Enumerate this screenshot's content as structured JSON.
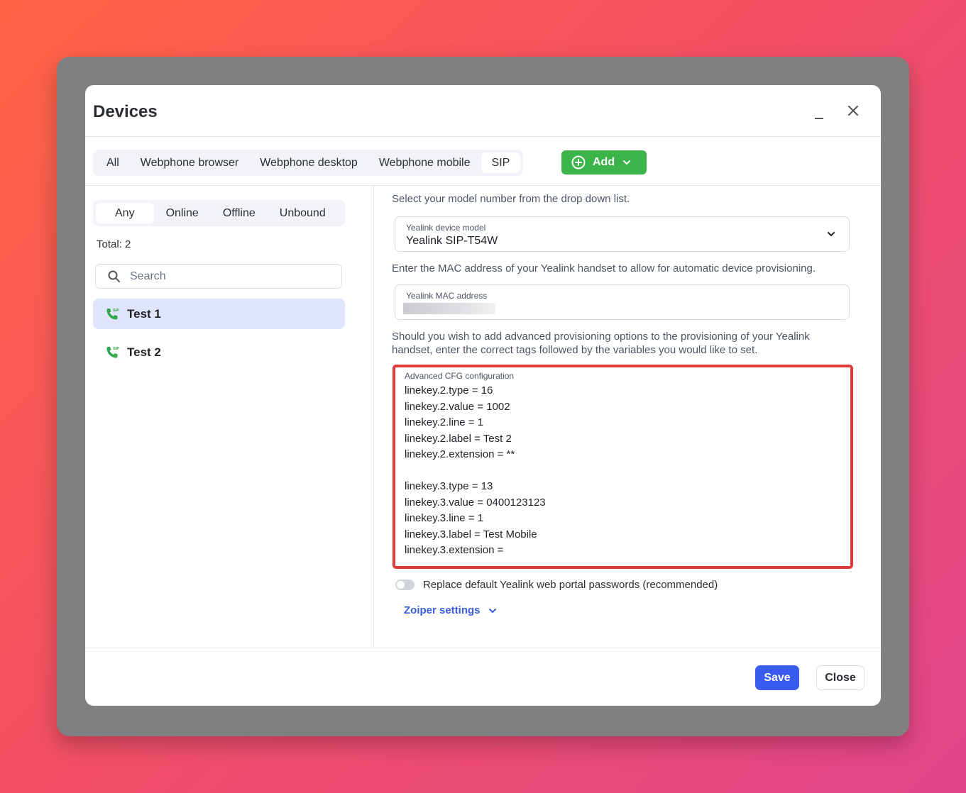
{
  "dialog": {
    "title": "Devices"
  },
  "tabs": [
    {
      "label": "All"
    },
    {
      "label": "Webphone browser"
    },
    {
      "label": "Webphone desktop"
    },
    {
      "label": "Webphone mobile"
    },
    {
      "label": "SIP",
      "active": true
    }
  ],
  "add_button": {
    "label": "Add"
  },
  "status_filter": [
    {
      "label": "Any",
      "active": true
    },
    {
      "label": "Online"
    },
    {
      "label": "Offline"
    },
    {
      "label": "Unbound"
    }
  ],
  "total": "Total: 2",
  "search": {
    "placeholder": "Search",
    "value": ""
  },
  "devices": [
    {
      "label": "Test 1",
      "selected": true,
      "icon": "sip-phone-icon"
    },
    {
      "label": "Test 2",
      "selected": false,
      "icon": "sip-phone-icon"
    }
  ],
  "config": {
    "model_hint": "Select your model number from the drop down list.",
    "model_field": {
      "label": "Yealink device model",
      "value": "Yealink SIP-T54W"
    },
    "mac_hint": "Enter the MAC address of your Yealink handset to allow for automatic device provisioning.",
    "mac_field": {
      "label": "Yealink MAC address",
      "value": ""
    },
    "advanced_hint_line1": "Should you wish to add advanced provisioning options to the provisioning of your Yealink",
    "advanced_hint_line2": "handset, enter the correct tags followed by the variables you would like to set.",
    "cfg_field": {
      "label": "Advanced CFG configuration",
      "value": "linekey.2.type = 16\nlinekey.2.value = 1002\nlinekey.2.line = 1\nlinekey.2.label = Test 2\nlinekey.2.extension = **\n\nlinekey.3.type = 13\nlinekey.3.value = 0400123123\nlinekey.3.line = 1\nlinekey.3.label = Test Mobile\nlinekey.3.extension ="
    },
    "replace_passwords": {
      "label": "Replace default Yealink web portal passwords (recommended)",
      "enabled": false
    },
    "zoiper": {
      "label": "Zoiper settings"
    }
  },
  "footer": {
    "save_label": "Save",
    "close_label": "Close"
  },
  "colors": {
    "accent": "#3a5bf0",
    "add_green": "#3bb54a",
    "highlight_red": "#e03a3a",
    "selected_bg": "#e0e5fb"
  }
}
